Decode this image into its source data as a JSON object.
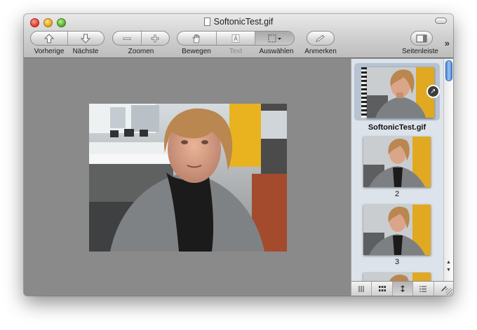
{
  "window": {
    "title": "SoftonicTest.gif"
  },
  "toolbar": {
    "prev_label": "Vorherige",
    "next_label": "Nächste",
    "zoom_label": "Zoomen",
    "move_label": "Bewegen",
    "text_label": "Text",
    "select_label": "Auswählen",
    "annotate_label": "Anmerken",
    "sidebar_label": "Seitenleiste",
    "overflow_label": "»"
  },
  "sidebar": {
    "thumbnails": [
      {
        "caption": "SoftonicTest.gif",
        "selected": true
      },
      {
        "caption": "2",
        "selected": false
      },
      {
        "caption": "3",
        "selected": false
      }
    ]
  },
  "colors": {
    "content_background": "#8a8a8a",
    "sidebar_background": "#dde3ea",
    "selection_highlight": "#b8c3d1",
    "scroll_thumb": "#4a86d6"
  },
  "icons": {
    "prev": "arrow-up-icon",
    "next": "arrow-down-icon",
    "zoom_out": "minus-icon",
    "zoom_in": "plus-icon",
    "move": "hand-icon",
    "text": "text-cursor-icon",
    "select": "selection-grid-icon",
    "annotate": "pencil-icon",
    "sidebar": "sidebar-icon",
    "share": "share-arrow-icon"
  }
}
